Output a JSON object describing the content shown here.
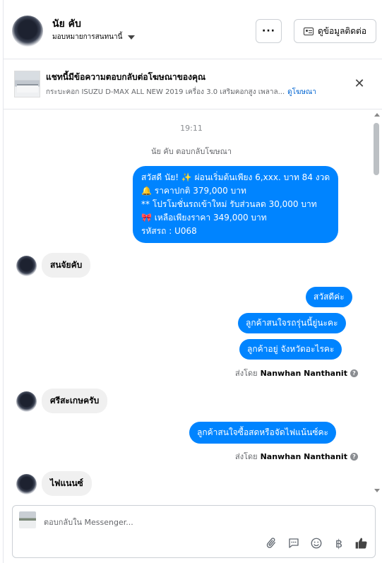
{
  "header": {
    "user_name": "นัย คับ",
    "assign_label": "มอบหมายการสนทนานี้",
    "more_label": "···",
    "contact_button_label": "ดูข้อมูลติดต่อ"
  },
  "ad_banner": {
    "title": "แชทนี้มีข้อความตอบกลับต่อโฆษณาของคุณ",
    "description": "กระบะคอก ISUZU D-MAX ALL NEW 2019 เครื่อง 3.0 เสริมคอกสูง เพลาล...",
    "link_label": "ดูโฆษณา",
    "close_icon": "close-icon"
  },
  "conversation": {
    "time": "19:11",
    "reply_note": "นัย คับ ตอบกลับโฆษณา",
    "ad_message_lines": [
      "สวัสดี นัย! ✨ ผ่อนเริ่มต้นเพียง 6,xxx. บาท 84 งวด",
      "🔔 ราคาปกติ 379,000 บาท",
      "** โปรโมชั่นรถเข้าใหม่ รับส่วนลด 30,000 บาท",
      "🎀 เหลือเพียงราคา 349,000 บาท",
      "รหัสรถ : U068"
    ],
    "incoming_1": "สนจัยคับ",
    "outgoing_1": "สวัสดีค่ะ",
    "outgoing_2": "ลูกค้าสนใจรถรุ่นนี้ยู่นะคะ",
    "outgoing_3": "ลูกค้าอยู่ จังหวัดอะไรคะ",
    "sent_by_prefix": "ส่งโดย",
    "sent_by_name": "Nanwhan Nanthanit",
    "incoming_2": "ศรีสะเกษครับ",
    "outgoing_4": "ลูกค้าสนใจซื้อสดหรือจัดไฟแน้นซ์คะ",
    "incoming_3": "ไฟแนนซ์"
  },
  "composer": {
    "placeholder": "ตอบกลับใน Messenger...",
    "icons": [
      "attachment-icon",
      "saved-reply-icon",
      "emoji-icon",
      "payment-icon",
      "like-icon"
    ]
  },
  "colors": {
    "outgoing_bubble": "#0084ff",
    "incoming_bubble": "#f0f0f0",
    "link": "#0064d1"
  }
}
